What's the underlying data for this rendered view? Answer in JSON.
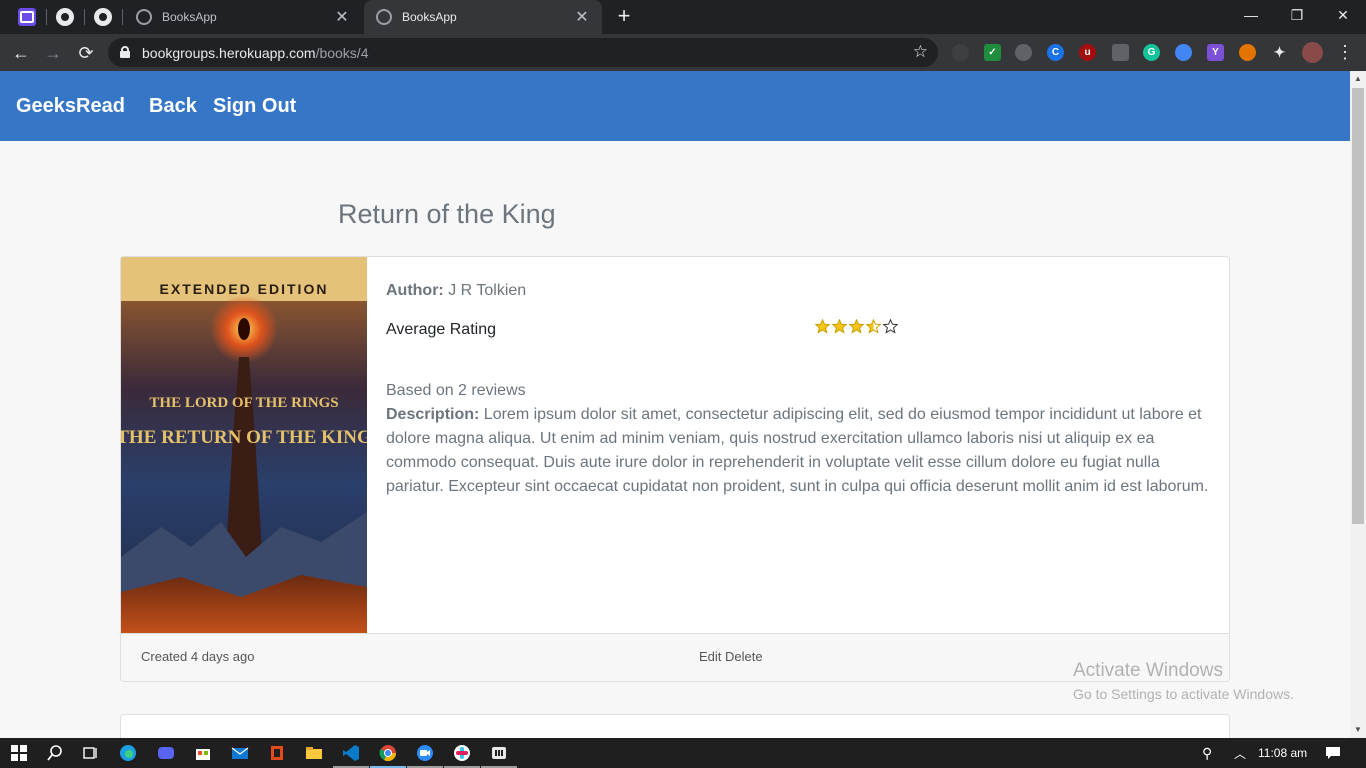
{
  "browser": {
    "tabs": [
      {
        "title": "BooksApp",
        "active": false
      },
      {
        "title": "BooksApp",
        "active": true
      }
    ],
    "url_host": "bookgroups.herokuapp.com",
    "url_path": "/books/4",
    "window_controls": {
      "minimize": "—",
      "restore": "❐",
      "close": "✕"
    }
  },
  "app": {
    "brand": "GeeksRead",
    "nav": {
      "back": "Back",
      "sign_out": "Sign Out"
    },
    "accent_color": "#3577c6"
  },
  "book": {
    "title": "Return of the King",
    "cover": {
      "edition": "EXTENDED EDITION",
      "line1": "THE LORD OF THE RINGS",
      "line2": "THE RETURN OF THE KING"
    },
    "author_label": "Author:",
    "author": "J R Tolkien",
    "rating_label": "Average Rating",
    "rating": 3.5,
    "rating_max": 5,
    "reviews_text": "Based on 2 reviews",
    "description_label": "Description:",
    "description": "Lorem ipsum dolor sit amet, consectetur adipiscing elit, sed do eiusmod tempor incididunt ut labore et dolore magna aliqua. Ut enim ad minim veniam, quis nostrud exercitation ullamco laboris nisi ut aliquip ex ea commodo consequat. Duis aute irure dolor in reprehenderit in voluptate velit esse cillum dolore eu fugiat nulla pariatur. Excepteur sint occaecat cupidatat non proident, sunt in culpa qui officia deserunt mollit anim id est laborum.",
    "created": "Created 4 days ago",
    "edit_label": "Edit",
    "delete_label": "Delete"
  },
  "watermark": {
    "line1": "Activate Windows",
    "line2": "Go to Settings to activate Windows."
  },
  "taskbar": {
    "time": "11:08 am"
  }
}
